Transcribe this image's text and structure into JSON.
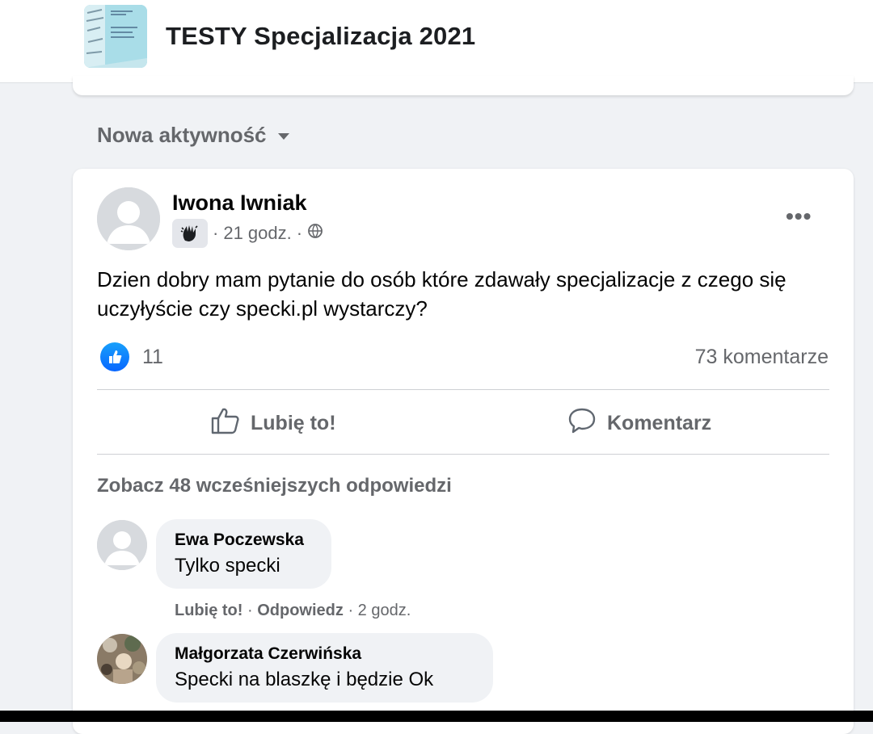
{
  "header": {
    "group_title": "TESTY Specjalizacja 2021"
  },
  "feed": {
    "sort_label": "Nowa aktywność"
  },
  "post": {
    "author": "Iwona Iwniak",
    "time": "21 godz.",
    "text": "Dzien dobry mam pytanie do osób które zdawały specjalizacje z czego się uczyłyście czy specki.pl wystarczy?",
    "reactions_count": "11",
    "comments_count": "73 komentarze",
    "like_label": "Lubię to!",
    "comment_label": "Komentarz",
    "previous_replies": "Zobacz 48 wcześniejszych odpowiedzi"
  },
  "comments": [
    {
      "author": "Ewa Poczewska",
      "text": "Tylko specki",
      "like": "Lubię to!",
      "reply": "Odpowiedz",
      "time": "2 godz."
    },
    {
      "author": "Małgorzata Czerwińska",
      "text": "Specki na blaszkę i będzie Ok"
    }
  ],
  "colors": {
    "accent": "#0866ff",
    "secondary_text": "#65676b",
    "background": "#f0f2f5"
  },
  "icons": [
    "group-cover-icon",
    "caret-down-icon",
    "more-options-icon",
    "globe-icon",
    "like-thumb-icon",
    "comment-icon",
    "hand-badge-icon"
  ]
}
